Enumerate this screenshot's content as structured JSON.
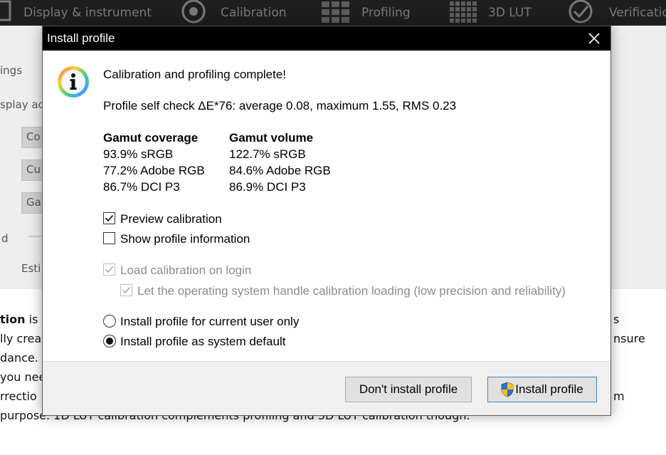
{
  "app": {
    "toolbar": [
      {
        "label": "Display & instrument",
        "icon": "display-icon"
      },
      {
        "label": "Calibration",
        "icon": "target-icon"
      },
      {
        "label": "Profiling",
        "icon": "grid-icon"
      },
      {
        "label": "3D LUT",
        "icon": "cube-icon"
      },
      {
        "label": "Verificatio",
        "icon": "checkmark-icon"
      }
    ],
    "panel": {
      "settings_fragment": "ings",
      "display_fragment": "splay ac",
      "button1": "Co",
      "button2": "Cu",
      "button3": "Ga",
      "label_d": "d",
      "label_esti": "Esti"
    },
    "body_lines": [
      {
        "bold": "tion",
        "rest": " is d",
        "right": "s"
      },
      {
        "bold": "",
        "rest": "lly crea",
        "right": "nsure"
      },
      {
        "bold": "",
        "rest": "dance. N",
        "right": ""
      },
      {
        "bold": "",
        "rest": "you nee",
        "right": ""
      },
      {
        "bold": "",
        "rest": "rrectio",
        "right": "m"
      },
      {
        "bold": "",
        "rest": " purpose. 1D LUT calibration complements profiling and 3D LUT calibration though.",
        "right": ""
      }
    ]
  },
  "dialog": {
    "title": "Install profile",
    "message": "Calibration and profiling complete!",
    "self_check": "Profile self check ΔE*76: average 0.08, maximum 1.55, RMS 0.23",
    "gamut_coverage": {
      "heading": "Gamut coverage",
      "values": [
        "93.9% sRGB",
        "77.2% Adobe RGB",
        "86.7% DCI P3"
      ]
    },
    "gamut_volume": {
      "heading": "Gamut volume",
      "values": [
        "122.7% sRGB",
        "84.6% Adobe RGB",
        "86.9% DCI P3"
      ]
    },
    "options": {
      "preview_calibration": {
        "label": "Preview calibration",
        "checked": true
      },
      "show_profile_info": {
        "label": "Show profile information",
        "checked": false
      },
      "load_calibration": {
        "label": "Load calibration on login",
        "checked": true,
        "disabled": true
      },
      "os_handle": {
        "label": "Let the operating system handle calibration loading (low precision and reliability)",
        "checked": true,
        "disabled": true
      }
    },
    "install_scope": {
      "current_user": {
        "label": "Install profile for current user only",
        "selected": false
      },
      "system_default": {
        "label": "Install profile as system default",
        "selected": true
      }
    },
    "buttons": {
      "dont_install": "Don't install profile",
      "install": "Install profile"
    }
  },
  "colors": {
    "titlebar": "#000000",
    "toolbar": "#1e1e1e",
    "primary_border": "#4a7fc1",
    "shield_blue": "#2f6fd0",
    "shield_yellow": "#f2c418"
  }
}
